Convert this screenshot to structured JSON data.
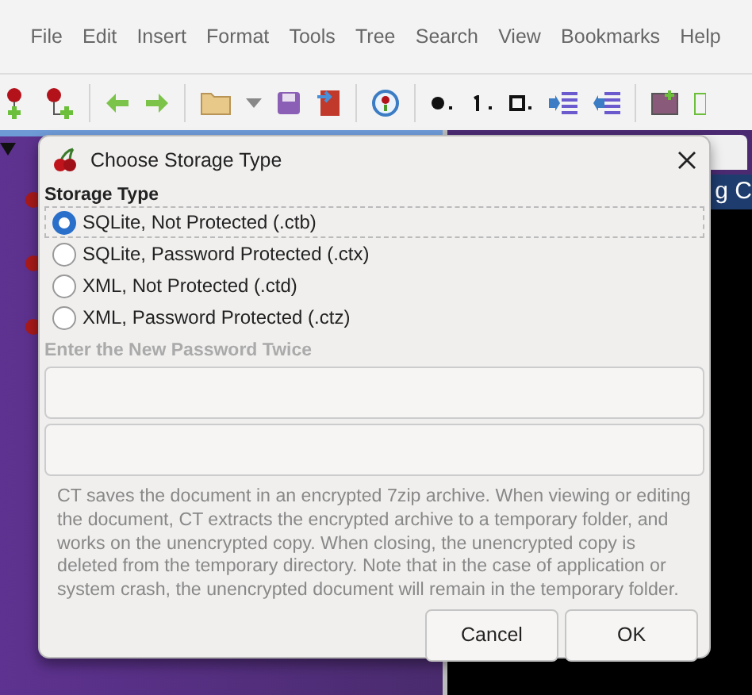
{
  "menu": [
    "File",
    "Edit",
    "Insert",
    "Format",
    "Tools",
    "Tree",
    "Search",
    "View",
    "Bookmarks",
    "Help"
  ],
  "editor": {
    "visible_text": "g C"
  },
  "dialog": {
    "title": "Choose Storage Type",
    "section_label": "Storage Type",
    "options": [
      {
        "label": "SQLite, Not Protected (.ctb)",
        "selected": true
      },
      {
        "label": "SQLite, Password Protected (.ctx)",
        "selected": false
      },
      {
        "label": "XML, Not Protected (.ctd)",
        "selected": false
      },
      {
        "label": "XML, Password Protected (.ctz)",
        "selected": false
      }
    ],
    "password": {
      "label": "Enter the New Password Twice",
      "disabled": true
    },
    "note": "CT saves the document in an encrypted 7zip archive. When viewing or editing the document, CT extracts the encrypted archive to a temporary folder, and works on the unencrypted copy. When closing, the unencrypted copy is deleted from the temporary directory. Note that in the case of application or system crash, the unencrypted document will remain in the temporary folder.",
    "buttons": [
      "Cancel",
      "OK"
    ]
  }
}
